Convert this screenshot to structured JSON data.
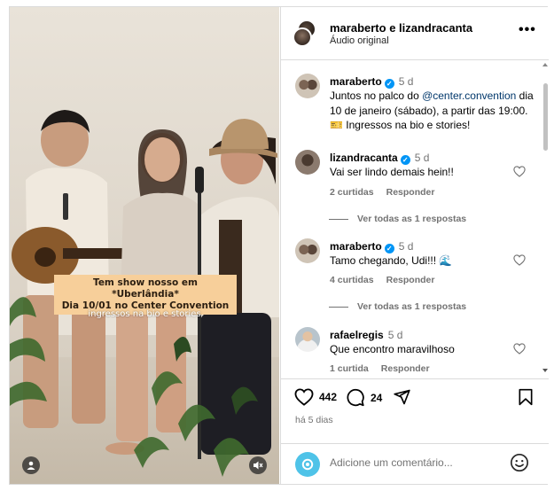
{
  "post": {
    "header": {
      "names": "maraberto e lizandracanta",
      "subtitle": "Áudio original",
      "more_label": "•••"
    },
    "media": {
      "caption_line1": "Tem show nosso em *Uberlândia*",
      "caption_line2": "Dia 10/01 no Center Convention",
      "caption_sub": "ingressos na bio e stories"
    },
    "description": {
      "username": "maraberto",
      "time": "5 d",
      "text_before": "Juntos no palco do ",
      "mention": "@center.convention",
      "text_after": " dia 10 de janeiro (sábado), a partir das 19:00. 🎫 Ingressos na bio e stories!"
    },
    "comments": [
      {
        "username": "lizandracanta",
        "time": "5 d",
        "text": "Vai ser lindo demais hein!!",
        "likes": "2 curtidas",
        "reply": "Responder",
        "view_replies": "Ver todas as 1 respostas"
      },
      {
        "username": "maraberto",
        "time": "5 d",
        "text": "Tamo chegando, Udi!!! 🌊",
        "likes": "4 curtidas",
        "reply": "Responder",
        "view_replies": "Ver todas as 1 respostas"
      },
      {
        "username": "rafaelregis",
        "time": "5 d",
        "text": "Que encontro maravilhoso",
        "likes": "1 curtida",
        "reply": "Responder"
      }
    ],
    "actions": {
      "likes_count": "442",
      "comments_count": "24",
      "date": "há 5 dias"
    },
    "composer": {
      "placeholder": "Adicione um comentário..."
    },
    "colors": {
      "verified": "#0095f6",
      "mention": "#00376b",
      "caption_box": "#f7cf9a",
      "secondary_text": "#737373"
    },
    "icons": [
      "more-icon",
      "verified-icon",
      "heart-icon",
      "comment-icon",
      "share-icon",
      "bookmark-icon",
      "emoji-icon",
      "user-tag-icon",
      "muted-icon",
      "threads-icon"
    ]
  }
}
